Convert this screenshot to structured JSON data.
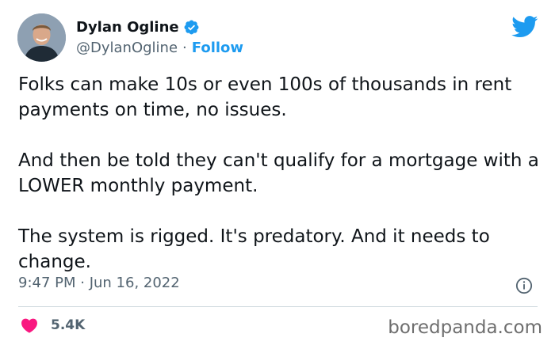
{
  "author": {
    "name": "Dylan Ogline",
    "handle": "@DylanOgline",
    "separator": "·",
    "follow_label": "Follow"
  },
  "tweet": {
    "paragraphs": [
      "Folks can make 10s or even 100s of thousands in rent payments on time, no issues.",
      "And then be told they can't qualify for a mortgage with a LOWER monthly payment.",
      "The system is rigged. It's predatory. And it needs to change."
    ],
    "timestamp": "9:47 PM · Jun 16, 2022"
  },
  "engagement": {
    "likes": "5.4K"
  },
  "watermark": "boredpanda.com",
  "icons": {
    "verified": "verified-badge-icon",
    "platform": "twitter-bird-icon",
    "info": "info-icon",
    "like": "heart-icon"
  },
  "colors": {
    "accent": "#1d9bf0",
    "heart": "#f91880",
    "muted": "#536471",
    "text": "#0f1419"
  }
}
